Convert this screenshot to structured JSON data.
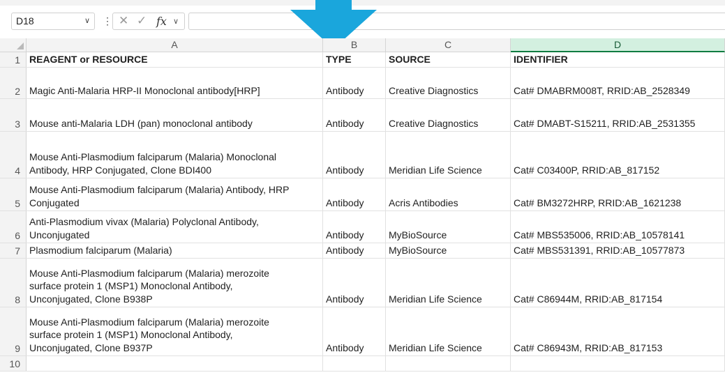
{
  "formula_bar": {
    "name_box": "D18",
    "formula": "",
    "cancel_icon": "x-icon",
    "enter_icon": "check-icon",
    "function_label": "fx"
  },
  "colors": {
    "selected_header": "#d3f0e0",
    "selected_accent": "#107c41",
    "arrow": "#1aa6dc"
  },
  "columns": [
    "A",
    "B",
    "C",
    "D"
  ],
  "rows": [
    {
      "num": "1",
      "a": "REAGENT or RESOURCE",
      "b": "TYPE",
      "c": "SOURCE",
      "d": "IDENTIFIER"
    },
    {
      "num": "2",
      "a": "Magic Anti-Malaria HRP-II Monoclonal antibody[HRP]",
      "b": "Antibody",
      "c": "Creative Diagnostics",
      "d": "Cat# DMABRM008T, RRID:AB_2528349"
    },
    {
      "num": "3",
      "a": "Mouse anti-Malaria LDH (pan) monoclonal antibody",
      "b": "Antibody",
      "c": "Creative Diagnostics",
      "d": "Cat# DMABT-S15211, RRID:AB_2531355"
    },
    {
      "num": "4",
      "a": "Mouse Anti-Plasmodium falciparum (Malaria) Monoclonal\nAntibody, HRP Conjugated, Clone BDI400",
      "b": "Antibody",
      "c": "Meridian Life Science",
      "d": "Cat# C03400P, RRID:AB_817152"
    },
    {
      "num": "5",
      "a": "Mouse Anti-Plasmodium falciparum (Malaria) Antibody, HRP\nConjugated",
      "b": "Antibody",
      "c": "Acris Antibodies",
      "d": "Cat# BM3272HRP, RRID:AB_1621238"
    },
    {
      "num": "6",
      "a": "Anti-Plasmodium vivax (Malaria) Polyclonal Antibody,\nUnconjugated",
      "b": "Antibody",
      "c": "MyBioSource",
      "d": "Cat# MBS535006, RRID:AB_10578141"
    },
    {
      "num": "7",
      "a": "Plasmodium falciparum (Malaria)",
      "b": "Antibody",
      "c": "MyBioSource",
      "d": "Cat# MBS531391, RRID:AB_10577873"
    },
    {
      "num": "8",
      "a": "Mouse Anti-Plasmodium falciparum (Malaria) merozoite\nsurface protein 1 (MSP1) Monoclonal Antibody,\nUnconjugated, Clone B938P",
      "b": "Antibody",
      "c": "Meridian Life Science",
      "d": "Cat# C86944M, RRID:AB_817154"
    },
    {
      "num": "9",
      "a": "Mouse Anti-Plasmodium falciparum (Malaria) merozoite\nsurface protein 1 (MSP1) Monoclonal Antibody,\nUnconjugated, Clone B937P",
      "b": "Antibody",
      "c": "Meridian Life Science",
      "d": "Cat# C86943M, RRID:AB_817153"
    },
    {
      "num": "10",
      "a": "",
      "b": "",
      "c": "",
      "d": ""
    }
  ]
}
